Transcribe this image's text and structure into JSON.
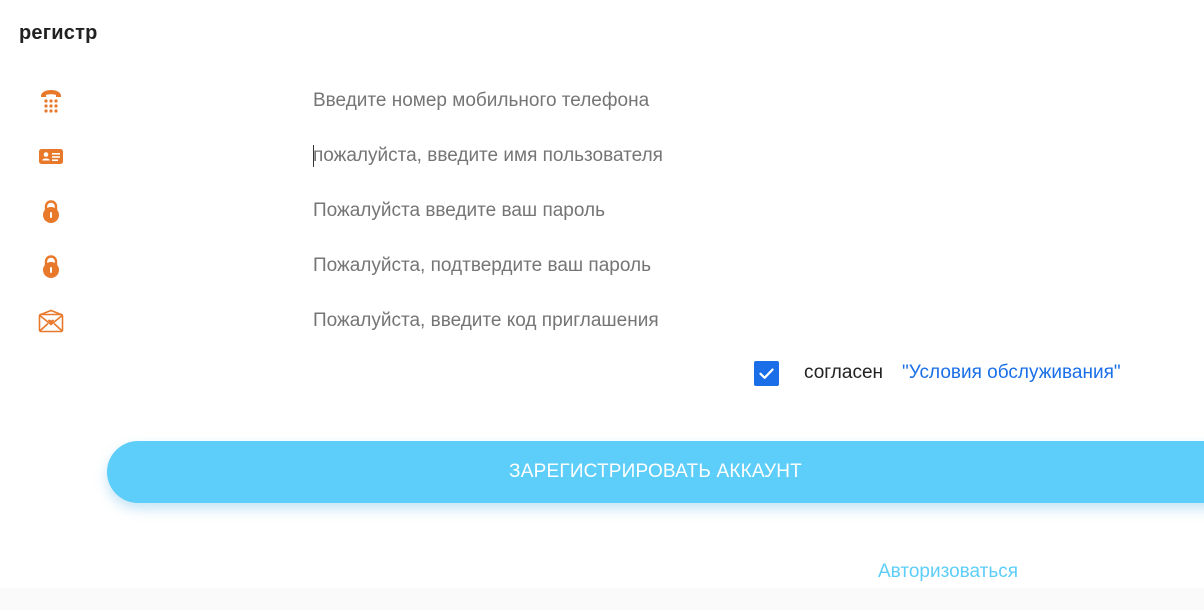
{
  "page": {
    "title": "регистр"
  },
  "form": {
    "fields": [
      {
        "name": "phone",
        "icon": "phone-icon",
        "placeholder": "Введите номер мобильного телефона",
        "value": ""
      },
      {
        "name": "username",
        "icon": "id-card-icon",
        "placeholder": "пожалуйста, введите имя пользователя",
        "value": ""
      },
      {
        "name": "password",
        "icon": "lock-icon",
        "placeholder": "Пожалуйста введите ваш пароль",
        "value": ""
      },
      {
        "name": "confirm-password",
        "icon": "lock-icon",
        "placeholder": "Пожалуйста, подтвердите ваш пароль",
        "value": ""
      },
      {
        "name": "invite-code",
        "icon": "envelope-icon",
        "placeholder": "Пожалуйста, введите код приглашения",
        "value": ""
      }
    ],
    "agree": {
      "checked": true,
      "label": "согласен",
      "link_text": "\"Условия обслуживания\""
    },
    "submit_label": "ЗАРЕГИСТРИРОВАТЬ АККАУНТ",
    "login_link": "Авторизоваться"
  },
  "colors": {
    "icon": "#e8782a",
    "accent_blue": "#1a6fe8",
    "button": "#5dcdf9",
    "link_light": "#5dcdf9"
  }
}
